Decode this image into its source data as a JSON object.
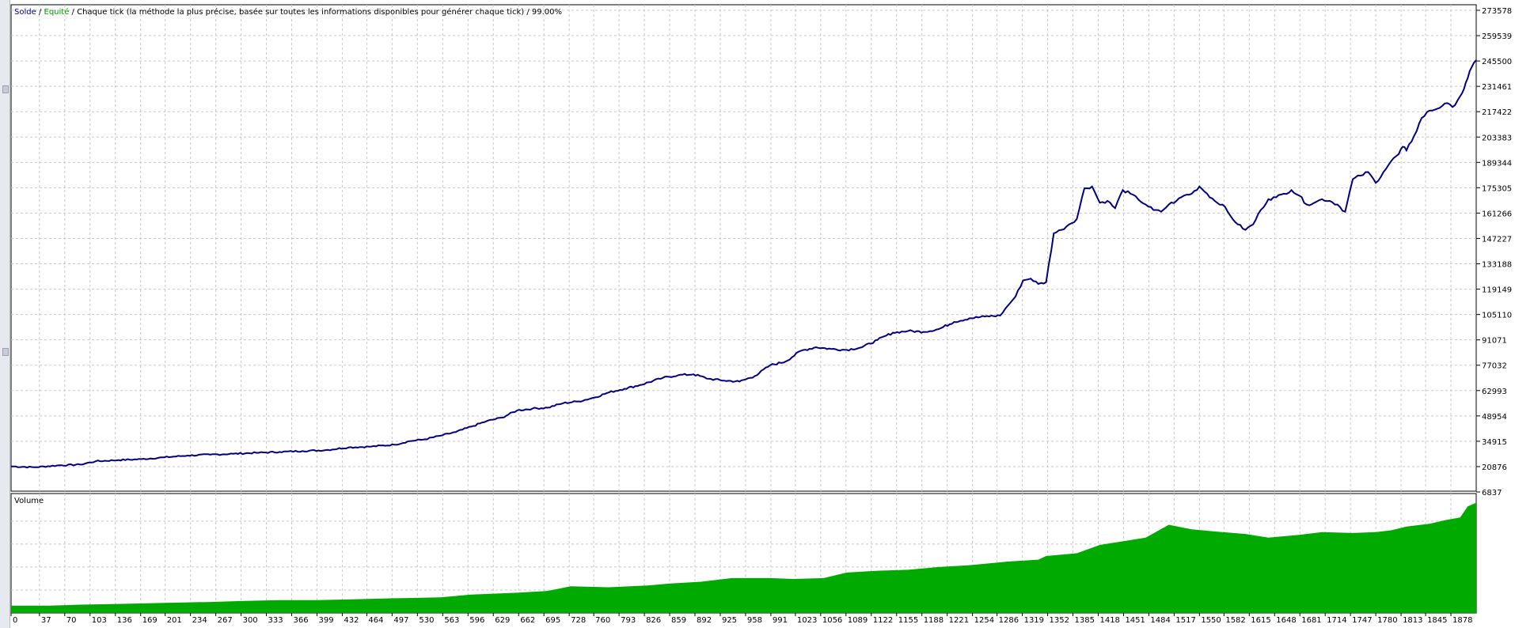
{
  "legend": {
    "balance": "Solde",
    "separator": " / ",
    "equity": "Equité",
    "description": "Chaque tick (la méthode la plus précise, basée sur toutes les informations disponibles pour générer chaque tick)",
    "quality": "99.00%"
  },
  "volume_label": "Volume",
  "colors": {
    "balance_line": "#000080",
    "equity_text": "#00a000",
    "volume_fill": "#00aa00",
    "grid": "#c8c8c8",
    "axis": "#000000"
  },
  "chart_data": [
    {
      "type": "line",
      "name": "Solde",
      "ylim": [
        6837,
        273578
      ],
      "xlim": [
        0,
        1911
      ],
      "y_ticks": [
        6837,
        20876,
        34915,
        48954,
        62993,
        77032,
        91071,
        105110,
        119149,
        133188,
        147227,
        161266,
        175305,
        189344,
        203383,
        217422,
        231461,
        245500,
        259539,
        273578
      ],
      "x_ticks": [
        0,
        37,
        70,
        103,
        136,
        169,
        201,
        234,
        267,
        300,
        333,
        366,
        399,
        432,
        464,
        497,
        530,
        563,
        596,
        629,
        662,
        695,
        728,
        760,
        793,
        826,
        859,
        892,
        925,
        958,
        991,
        1023,
        1056,
        1089,
        1122,
        1155,
        1188,
        1221,
        1254,
        1286,
        1319,
        1352,
        1385,
        1418,
        1451,
        1484,
        1517,
        1550,
        1582,
        1615,
        1648,
        1681,
        1714,
        1747,
        1780,
        1813,
        1845,
        1878
      ],
      "x": [
        0,
        30,
        60,
        90,
        110,
        140,
        170,
        200,
        230,
        260,
        290,
        320,
        350,
        380,
        410,
        440,
        470,
        500,
        520,
        540,
        560,
        580,
        600,
        620,
        640,
        660,
        680,
        700,
        720,
        740,
        760,
        780,
        800,
        820,
        850,
        870,
        890,
        910,
        930,
        950,
        970,
        990,
        1010,
        1030,
        1050,
        1070,
        1090,
        1110,
        1130,
        1150,
        1170,
        1190,
        1210,
        1230,
        1250,
        1270,
        1290,
        1300,
        1310,
        1320,
        1330,
        1340,
        1350,
        1360,
        1370,
        1380,
        1390,
        1400,
        1410,
        1420,
        1430,
        1440,
        1450,
        1460,
        1470,
        1480,
        1490,
        1500,
        1510,
        1520,
        1530,
        1540,
        1550,
        1560,
        1570,
        1580,
        1590,
        1600,
        1610,
        1620,
        1630,
        1640,
        1650,
        1660,
        1670,
        1680,
        1690,
        1700,
        1710,
        1720,
        1730,
        1740,
        1750,
        1760,
        1770,
        1780,
        1790,
        1800,
        1810,
        1815,
        1820,
        1830,
        1840,
        1850,
        1860,
        1870,
        1880,
        1890,
        1895,
        1900,
        1905,
        1911
      ],
      "y": [
        21000,
        20500,
        21500,
        22000,
        23800,
        24500,
        25000,
        26000,
        27000,
        27500,
        28000,
        28500,
        29000,
        29500,
        30000,
        31500,
        32000,
        33000,
        35000,
        36000,
        38000,
        40000,
        43000,
        46000,
        48000,
        52000,
        53000,
        53500,
        56000,
        57000,
        59000,
        62000,
        64000,
        66000,
        70000,
        71500,
        72000,
        69500,
        68500,
        68000,
        71000,
        77000,
        79000,
        85000,
        87000,
        86000,
        85500,
        87000,
        91000,
        95000,
        96000,
        95500,
        97000,
        101000,
        103000,
        104000,
        104500,
        110000,
        115000,
        124000,
        125000,
        122000,
        123000,
        150000,
        152000,
        155000,
        158000,
        175000,
        176000,
        167000,
        168000,
        164000,
        174000,
        172000,
        169000,
        166000,
        163000,
        162000,
        166000,
        168000,
        171000,
        172000,
        176000,
        172000,
        168000,
        166000,
        160000,
        155000,
        152000,
        155000,
        163000,
        169000,
        170000,
        172000,
        174000,
        171000,
        166000,
        167000,
        169000,
        168000,
        166000,
        162000,
        180000,
        182000,
        184000,
        178000,
        184000,
        190000,
        194000,
        198000,
        196000,
        204000,
        214000,
        218000,
        219000,
        222000,
        220000,
        226000,
        230000,
        236000,
        242000,
        246000,
        240000,
        248000,
        256000,
        262000,
        258000,
        247000,
        249000,
        250000
      ]
    },
    {
      "type": "area",
      "name": "Volume",
      "x": [
        0,
        50,
        90,
        150,
        200,
        260,
        300,
        350,
        400,
        450,
        500,
        560,
        600,
        660,
        700,
        730,
        780,
        830,
        860,
        900,
        940,
        990,
        1020,
        1060,
        1090,
        1130,
        1170,
        1210,
        1250,
        1300,
        1340,
        1350,
        1390,
        1420,
        1450,
        1480,
        1510,
        1540,
        1580,
        1610,
        1640,
        1680,
        1710,
        1750,
        1780,
        1800,
        1820,
        1850,
        1870,
        1890,
        1900,
        1911
      ],
      "values": [
        8,
        8,
        9,
        10,
        11,
        12,
        13,
        14,
        14,
        15,
        16,
        17,
        20,
        22,
        24,
        29,
        28,
        30,
        32,
        34,
        38,
        38,
        37,
        38,
        44,
        46,
        47,
        50,
        52,
        56,
        58,
        62,
        65,
        74,
        78,
        82,
        96,
        91,
        88,
        86,
        82,
        85,
        88,
        87,
        88,
        90,
        94,
        97,
        101,
        104,
        116,
        120
      ]
    }
  ]
}
